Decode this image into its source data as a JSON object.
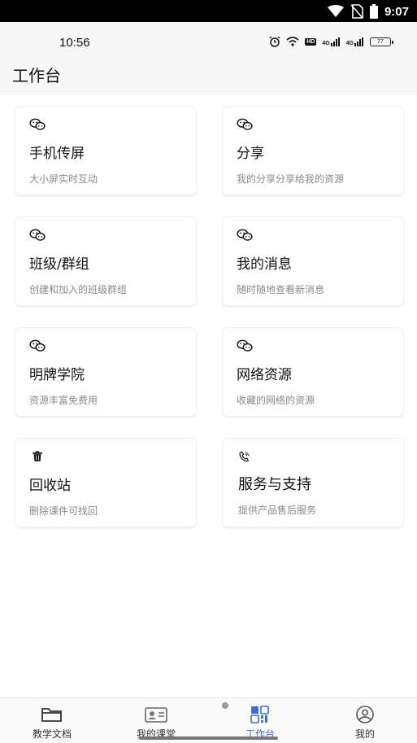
{
  "system_bar": {
    "time": "9:07"
  },
  "app_status": {
    "time": "10:56",
    "hd_label": "HD",
    "network_1": "4G",
    "network_2": "4G",
    "battery": "77"
  },
  "header": {
    "title": "工作台"
  },
  "cards": [
    {
      "title": "手机传屏",
      "subtitle": "大小屏实时互动",
      "icon": "wechat-icon"
    },
    {
      "title": "分享",
      "subtitle": "我的分享分享给我的资源",
      "icon": "wechat-icon"
    },
    {
      "title": "班级/群组",
      "subtitle": "创建和加入的班级群组",
      "icon": "wechat-icon"
    },
    {
      "title": "我的消息",
      "subtitle": "随时随地查看新消息",
      "icon": "wechat-icon"
    },
    {
      "title": "明牌学院",
      "subtitle": "资源丰富免费用",
      "icon": "wechat-icon"
    },
    {
      "title": "网络资源",
      "subtitle": "收藏的网络的资源",
      "icon": "wechat-icon"
    },
    {
      "title": "回收站",
      "subtitle": "删除课件可找回",
      "icon": "trash-icon"
    },
    {
      "title": "服务与支持",
      "subtitle": "提供产品售后服务",
      "icon": "phone-icon"
    }
  ],
  "bottom_nav": [
    {
      "label": "教学文档",
      "icon": "folder-icon"
    },
    {
      "label": "我的课堂",
      "icon": "id-card-icon"
    },
    {
      "label": "工作台",
      "icon": "grid-icon",
      "active": true
    },
    {
      "label": "我的",
      "icon": "user-icon"
    }
  ],
  "colors": {
    "accent": "#3a6fd8",
    "background": "#f7f7f7"
  }
}
